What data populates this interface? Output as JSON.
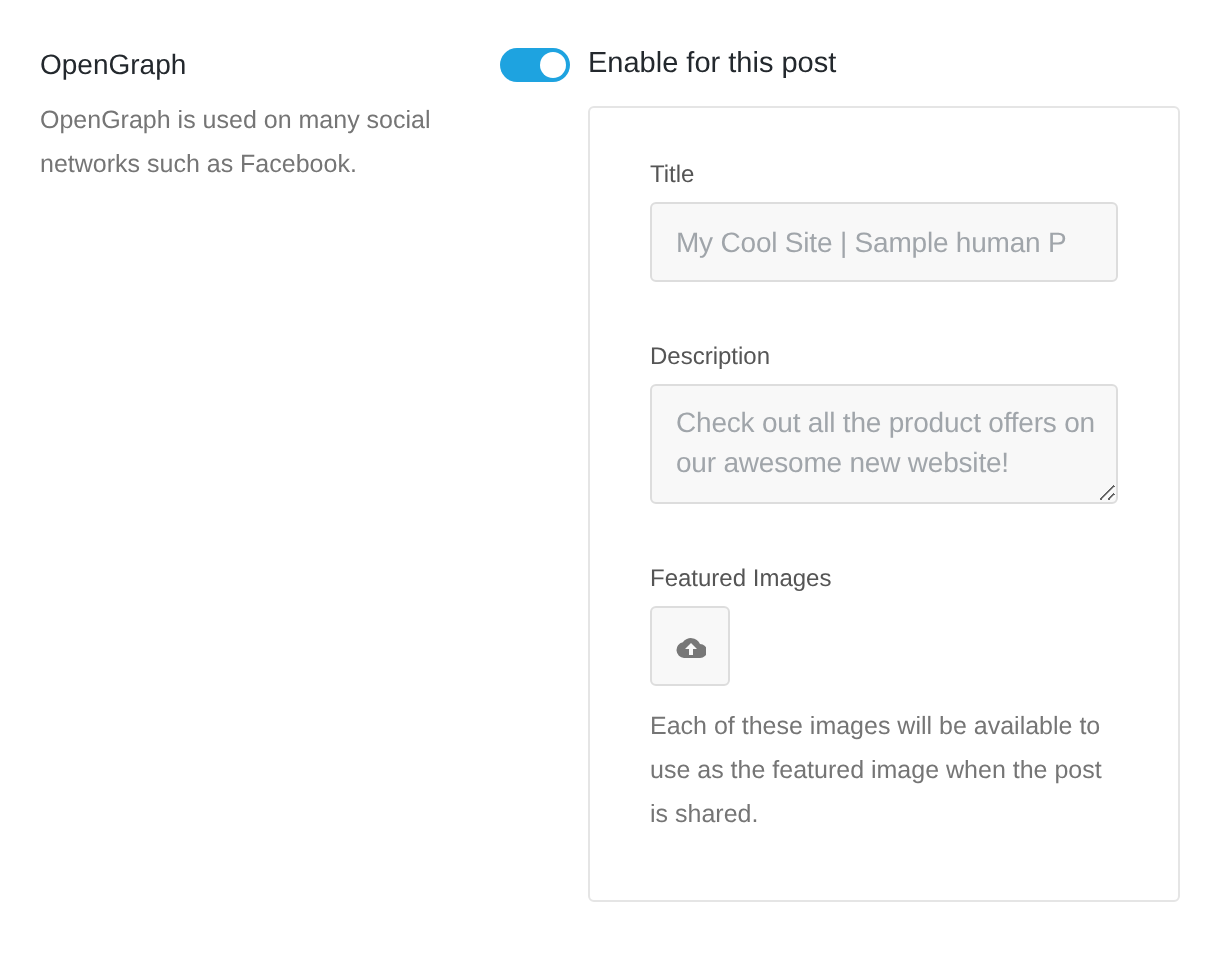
{
  "section": {
    "title": "OpenGraph",
    "description": "OpenGraph is used on many social networks such as Facebook."
  },
  "toggle": {
    "on": true,
    "label": "Enable for this post"
  },
  "fields": [
    {
      "kind": "input",
      "label": "Title",
      "placeholder": "My Cool Site | Sample human P"
    },
    {
      "kind": "textarea",
      "label": "Description",
      "placeholder": "Check out all the product offers on our awesome new website!"
    },
    {
      "kind": "upload",
      "label": "Featured Images",
      "help": "Each of these images will be available to use as the featured image when the post is shared."
    }
  ]
}
